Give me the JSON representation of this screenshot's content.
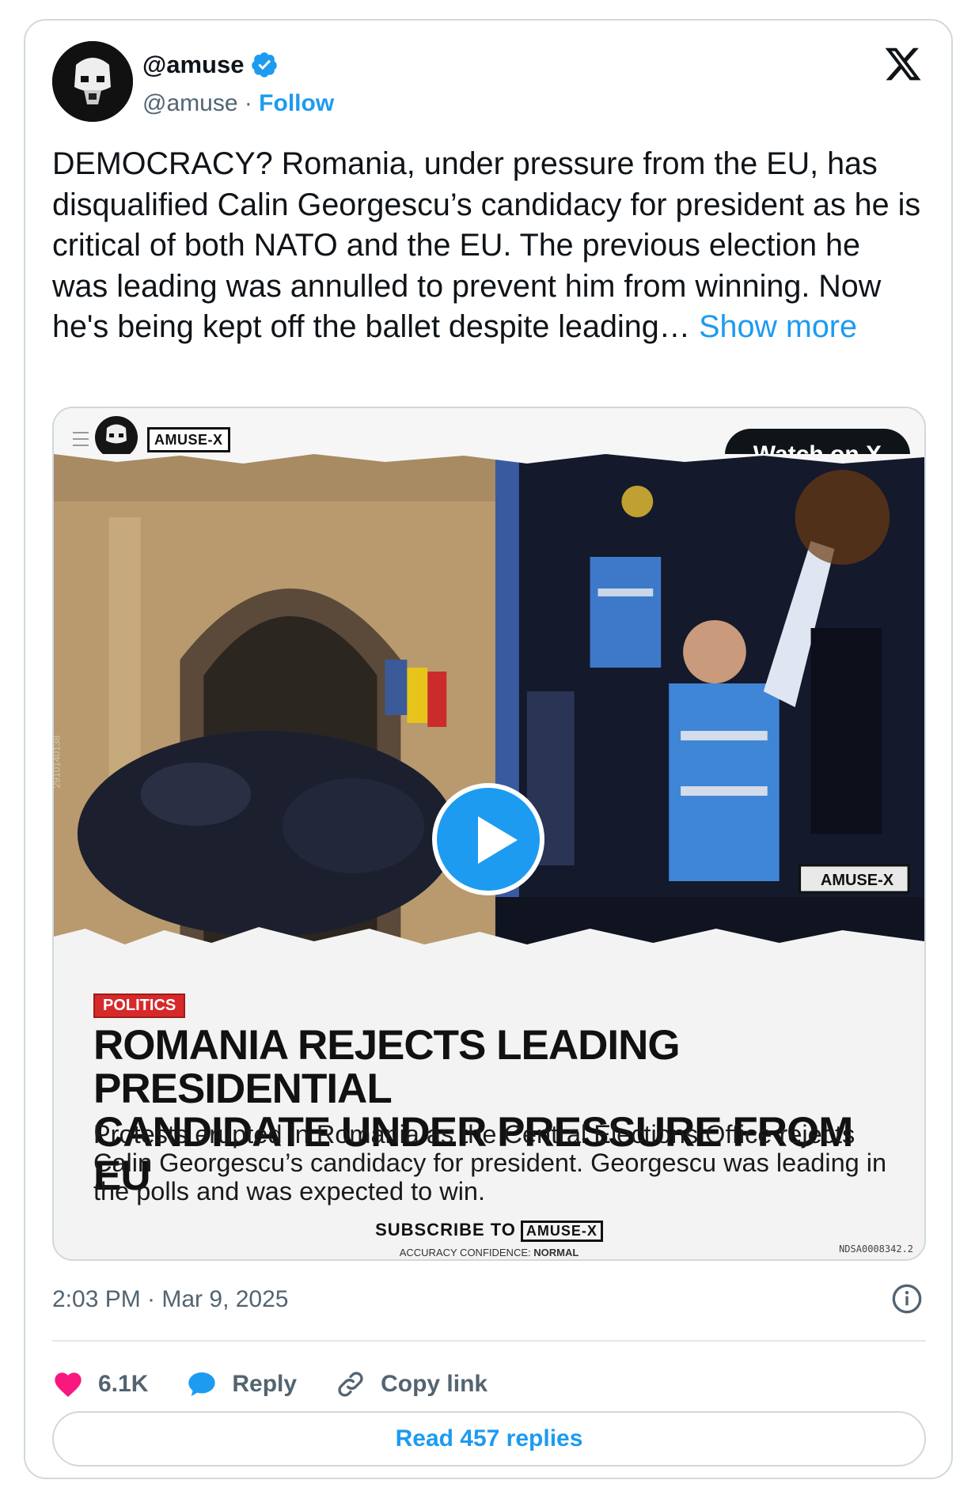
{
  "author": {
    "display_name": "@amuse",
    "handle": "@amuse",
    "separator": " · ",
    "follow_label": "Follow"
  },
  "tweet": {
    "text": "DEMOCRACY? Romania, under pressure from the EU, has disqualified Calin Georgescu’s candidacy for president as he is critical of both NATO and the EU. The previous election he was leading was annulled to prevent him from winning. Now he's being kept off the ballet despite leading… ",
    "show_more": "Show more",
    "timestamp": "2:03 PM · Mar 9, 2025"
  },
  "media": {
    "watch_label": "Watch on X",
    "brand_badge": "AMUSE-X",
    "watermark_badge": "AMUSE-X",
    "tag": "POLITICS",
    "headline_line1": "ROMANIA REJECTS LEADING PRESIDENTIAL",
    "headline_line2": "CANDIDATE UNDER PRESSURE FROM EU",
    "subtext": "Protests erupted in Romania as the Central Elections Office rejects Calin Georgescu’s candidacy for president. Georgescu was leading in the polls and was expected to win.",
    "subscribe_label": "SUBSCRIBE TO",
    "subscribe_brand": "AMUSE-X",
    "accuracy_prefix": "ACCURACY CONFIDENCE: ",
    "accuracy_value": "NORMAL",
    "code": "NDSA0008342.2",
    "side_code": "2910140138"
  },
  "actions": {
    "likes": "6.1K",
    "reply": "Reply",
    "copy_link": "Copy link"
  },
  "read_replies": "Read 457 replies",
  "colors": {
    "accent": "#1d9bf0",
    "like": "#f91880",
    "text": "#0f1419",
    "muted": "#536471",
    "tag_red": "#d6292a"
  },
  "icons": [
    "verified-badge-icon",
    "x-logo-icon",
    "play-icon",
    "info-icon",
    "heart-icon",
    "reply-bubble-icon",
    "link-icon"
  ]
}
